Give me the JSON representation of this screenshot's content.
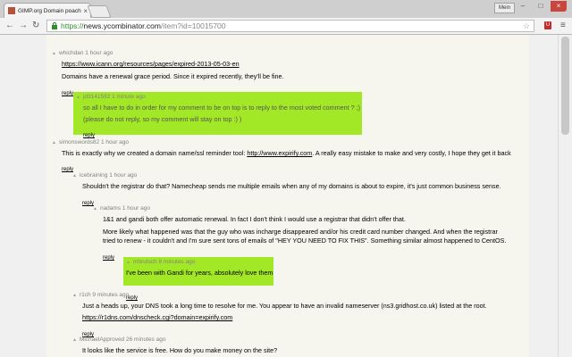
{
  "browser": {
    "tab_title": "GIMP.org Domain poach",
    "tab_close": "×",
    "user_label": "Mein",
    "window_minimize": "–",
    "window_maximize": "□",
    "window_close": "×",
    "nav_back": "←",
    "nav_forward": "→",
    "nav_reload": "↻",
    "url_scheme": "https://",
    "url_host": "news.ycombinator.com",
    "url_path": "/item?id=10015700",
    "bookmark_star": "☆",
    "extension_label": "U",
    "menu_glyph": "≡"
  },
  "comments": {
    "c1": {
      "user": "whichdan",
      "age": "1 hour ago",
      "link": "https://www.icann.org/resources/pages/expired-2013-05-03-en",
      "text": "Domains have a renewal grace period. Since it expired recently, they'll be fine.",
      "reply": "reply"
    },
    "c2": {
      "user": "jd3141592",
      "age": "1 minute ago",
      "text1": "so all I have to do in order for my comment to be on top is to reply to the most voted comment ? ;)",
      "text2": "(please do not reply, so my comment will stay on top :) )",
      "reply": "reply"
    },
    "c3": {
      "user": "simonswords82",
      "age": "1 hour ago",
      "text_before": "This is exactly why we created a domain name/ssl reminder tool: ",
      "link": "http://www.expirify.com",
      "text_after": ". A really easy mistake to make and very costly, I hope they get it back",
      "reply": "reply"
    },
    "c4": {
      "user": "icebraining",
      "age": "1 hour ago",
      "text": "Shouldn't the registrar do that? Namecheap sends me multiple emails when any of my domains is about to expire, it's just common business sense.",
      "reply": "reply"
    },
    "c5": {
      "user": "nadams",
      "age": "1 hour ago",
      "text1": "1&1 and gandi both offer automatic renewal. In fact I don't think I would use a registrar that didn't offer that.",
      "text2": "More likely what happened was that the guy who was incharge disappeared and/or his credit card number changed. And when the registrar",
      "text3": "tried to renew - it couldn't and I'm sure sent tons of emails of \"HEY YOU NEED TO FIX THIS\". Something similar almost happened to CentOS.",
      "reply": "reply"
    },
    "c6": {
      "user": "mbrutsch",
      "age": "8 minutes ago",
      "text": "I've been with Gandi for years, absolutely love them",
      "reply": "reply"
    },
    "c7": {
      "user": "r1ch",
      "age": "9 minutes ago",
      "text": "Just a heads up, your DNS took a long time to resolve for me. You appear to have an invalid nameserver (ns3.gridhost.co.uk) listed at the root.",
      "link": "https://r1dns.com/dnscheck.cgi?domain=expirify.com",
      "reply": "reply"
    },
    "c8": {
      "user": "MichaelApproved",
      "age": "26 minutes ago",
      "text": "It looks like the service is free. How do you make money on the site?"
    }
  },
  "colors": {
    "highlight": "#a3e826",
    "hn_background": "#f6f6ef",
    "meta_gray": "#828282",
    "https_green": "#2c8d2c"
  }
}
